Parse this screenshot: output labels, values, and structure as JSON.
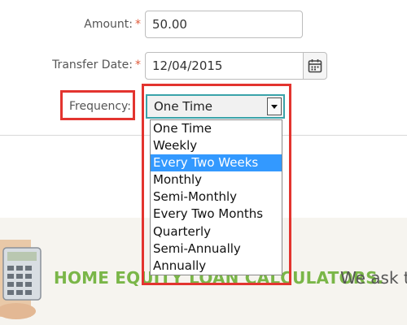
{
  "form": {
    "amount": {
      "label": "Amount:",
      "required_mark": "*",
      "value": "50.00"
    },
    "transfer_date": {
      "label": "Transfer Date:",
      "required_mark": "*",
      "value": "12/04/2015",
      "icon": "calendar-icon"
    },
    "frequency": {
      "label": "Frequency:",
      "selected": "One Time",
      "options": [
        "One Time",
        "Weekly",
        "Every Two Weeks",
        "Monthly",
        "Semi-Monthly",
        "Every Two Months",
        "Quarterly",
        "Semi-Annually",
        "Annually"
      ],
      "highlighted_option": "Every Two Weeks",
      "highlighted_option_index": 2
    }
  },
  "banner": {
    "title": "HOME EQUITY LOAN CALCULATORS.",
    "subtitle": "We ask th"
  },
  "colors": {
    "required": "#e05a3a",
    "annotation_box": "#e3342f",
    "select_focus_border": "#3aa3a9",
    "option_highlight": "#3399ff",
    "banner_green": "#7ab648"
  }
}
